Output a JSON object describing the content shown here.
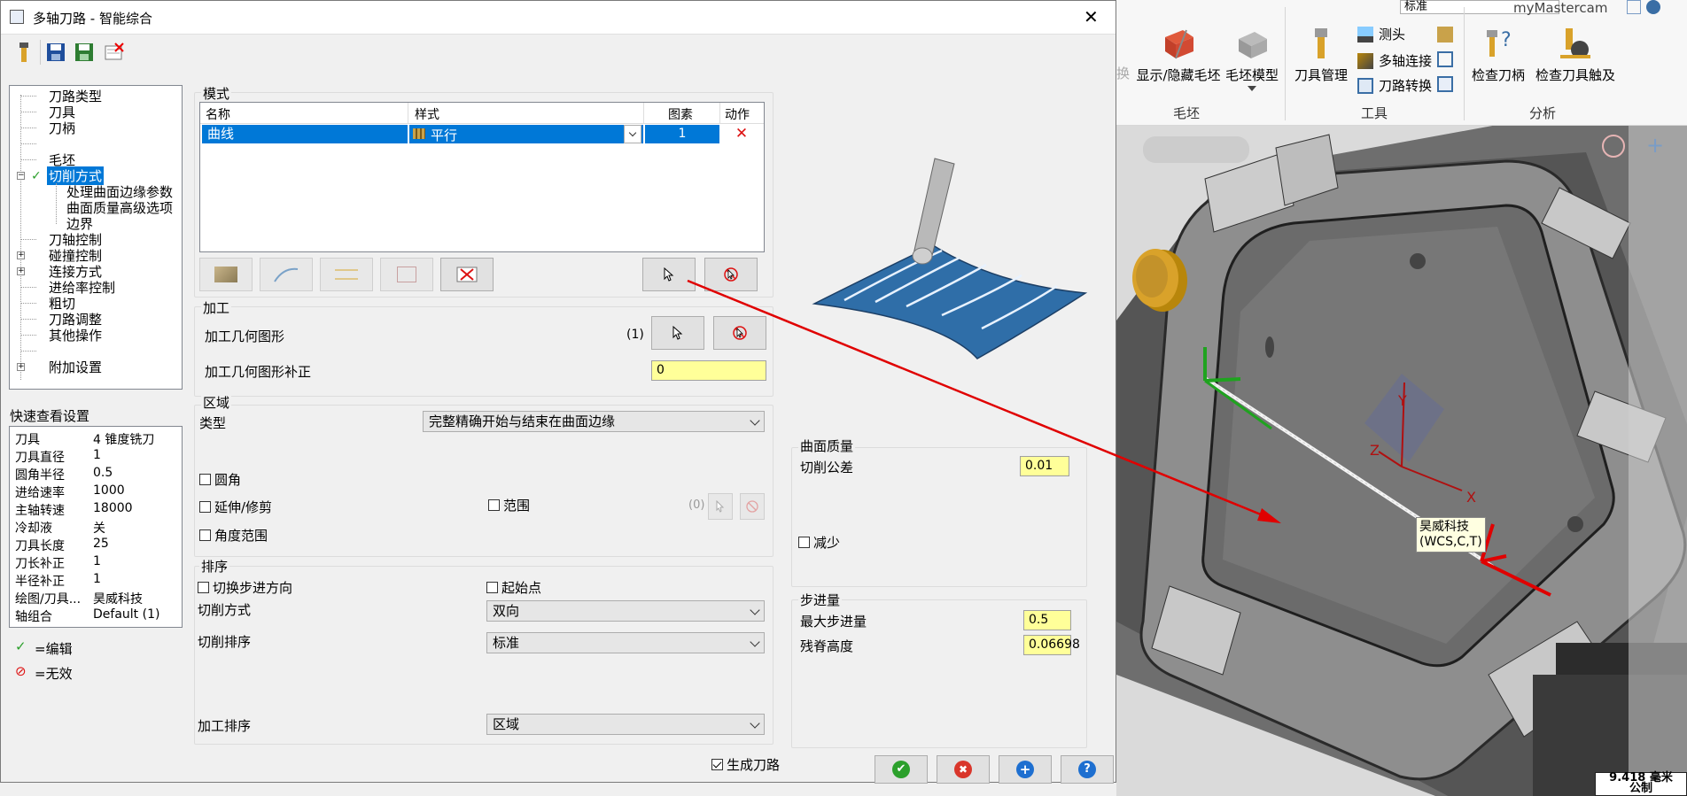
{
  "dialog": {
    "title": "多轴刀路 - 智能综合",
    "close_glyph": "✕"
  },
  "tree": {
    "items": [
      {
        "label": "刀路类型"
      },
      {
        "label": "刀具"
      },
      {
        "label": "刀柄"
      },
      {
        "label": ""
      },
      {
        "label": "毛坯"
      },
      {
        "label": "切削方式"
      },
      {
        "label": "处理曲面边缘参数"
      },
      {
        "label": "曲面质量高级选项"
      },
      {
        "label": "边界"
      },
      {
        "label": "刀轴控制"
      },
      {
        "label": "碰撞控制"
      },
      {
        "label": "连接方式"
      },
      {
        "label": "进给率控制"
      },
      {
        "label": "粗切"
      },
      {
        "label": "刀路调整"
      },
      {
        "label": "其他操作"
      },
      {
        "label": ""
      },
      {
        "label": "附加设置"
      }
    ]
  },
  "quick_view": {
    "title": "快速查看设置",
    "rows": [
      {
        "key": "刀具",
        "value": "4 锥度铣刀"
      },
      {
        "key": "刀具直径",
        "value": "1"
      },
      {
        "key": "圆角半径",
        "value": "0.5"
      },
      {
        "key": "进给速率",
        "value": "1000"
      },
      {
        "key": "主轴转速",
        "value": "18000"
      },
      {
        "key": "冷却液",
        "value": "关"
      },
      {
        "key": "刀具长度",
        "value": "25"
      },
      {
        "key": "刀长补正",
        "value": "1"
      },
      {
        "key": "半径补正",
        "value": "1"
      },
      {
        "key": "绘图/刀具...",
        "value": "昊威科技"
      },
      {
        "key": "轴组合",
        "value": "Default (1)"
      }
    ],
    "legend_edit": "=编辑",
    "legend_invalid": "=无效"
  },
  "mode": {
    "group_label": "模式",
    "columns": [
      "名称",
      "样式",
      "图素",
      "动作"
    ],
    "row": {
      "name": "曲线",
      "style": "平行",
      "count": "1"
    }
  },
  "machining": {
    "group_label": "加工",
    "geometry_label": "加工几何图形",
    "geometry_count": "(1)",
    "offset_label": "加工几何图形补正",
    "offset_value": "0"
  },
  "region": {
    "group_label": "区域",
    "type_label": "类型",
    "type_value": "完整精确开始与结束在曲面边缘",
    "fillet": "圆角",
    "extend_trim": "延伸/修剪",
    "range": "范围",
    "range_count": "(0)",
    "angle_range": "角度范围"
  },
  "order": {
    "group_label": "排序",
    "switch_dir": "切换步进方向",
    "start_point": "起始点",
    "cut_method_label": "切削方式",
    "cut_method_value": "双向",
    "cut_order_label": "切削排序",
    "cut_order_value": "标准",
    "mach_order_label": "加工排序",
    "mach_order_value": "区域"
  },
  "surface_quality": {
    "group_label": "曲面质量",
    "tolerance_label": "切削公差",
    "tolerance_value": "0.01",
    "reduce": "减少"
  },
  "stepover": {
    "group_label": "步进量",
    "max_label": "最大步进量",
    "max_value": "0.5",
    "scallop_label": "残脊高度",
    "scallop_value": "0.06698"
  },
  "footer": {
    "generate": "生成刀路"
  },
  "ribbon": {
    "combo_value": "标准",
    "brand": "myMastercam",
    "cut_left": "换",
    "show_hide_stock": "显示/隐藏毛坯",
    "stock_model": "毛坯模型",
    "tool_manager": "刀具管理",
    "probe": "测头",
    "multiaxis_link": "多轴连接",
    "toolpath_transform": "刀路转换",
    "check_holder": "检查刀柄",
    "check_reach": "检查刀具触及",
    "group_stock": "毛坯",
    "group_tools": "工具",
    "group_analysis": "分析"
  },
  "viewport": {
    "axis_x": "X",
    "axis_y": "Y",
    "axis_z": "Z",
    "wcs_line1": "昊威科技",
    "wcs_line2": "(WCS,C,T)",
    "scale_value": "9.418 毫米",
    "scale_unit": "公制"
  },
  "colors": {
    "selection_blue": "#0078d7",
    "field_yellow": "#ffff99",
    "arrow_red": "#e00000"
  }
}
